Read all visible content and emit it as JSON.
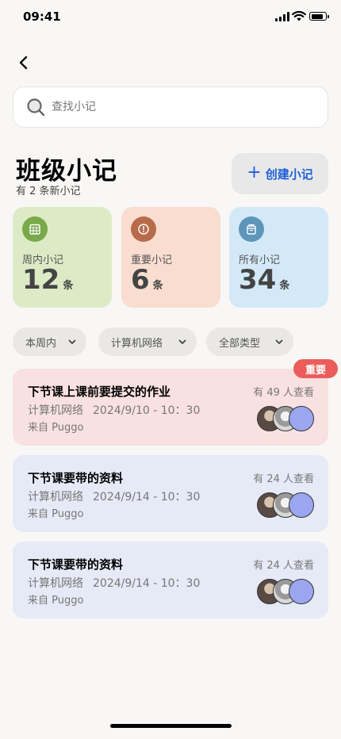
{
  "status_bar": {
    "time": "09:41",
    "battery_level": 0.85
  },
  "search": {
    "placeholder": "查找小记",
    "value": ""
  },
  "header": {
    "title": "班级小记",
    "subtitle": "有 2 条新小记"
  },
  "create_button": {
    "label": "创建小记",
    "icon": "plus-icon",
    "color": "#1d5fd6"
  },
  "stats": [
    {
      "label": "周内小记",
      "value": "12",
      "unit": "条",
      "icon": "calendar-icon",
      "bg": "#dcebc6",
      "icon_bg": "#7aa84a"
    },
    {
      "label": "重要小记",
      "value": "6",
      "unit": "条",
      "icon": "alert-icon",
      "bg": "#f8ddd0",
      "icon_bg": "#b86b4a"
    },
    {
      "label": "所有小记",
      "value": "34",
      "unit": "条",
      "icon": "archive-icon",
      "bg": "#d3e9f8",
      "icon_bg": "#5d96b8"
    }
  ],
  "filters": [
    {
      "label": "本周内"
    },
    {
      "label": "计算机网络"
    },
    {
      "label": "全部类型"
    }
  ],
  "notes": [
    {
      "title": "下节课上课前要提交的作业",
      "course": "计算机网络",
      "time": "2024/9/10 - 10：30",
      "source": "来自 Puggo",
      "views": "有 49 人查看",
      "badge": "重要",
      "bg": "#f8e1e0"
    },
    {
      "title": "下节课要带的资料",
      "course": "计算机网络",
      "time": "2024/9/14 - 10：30",
      "source": "来自 Puggo",
      "views": "有 24 人查看",
      "bg": "#e6e9f6"
    },
    {
      "title": "下节课要带的资料",
      "course": "计算机网络",
      "time": "2024/9/14 - 10：30",
      "source": "来自 Puggo",
      "views": "有 24 人查看",
      "bg": "#e6e9f6"
    }
  ],
  "colors": {
    "badge": "#ea5d5a",
    "avatar_third": "#9aa6ef"
  }
}
